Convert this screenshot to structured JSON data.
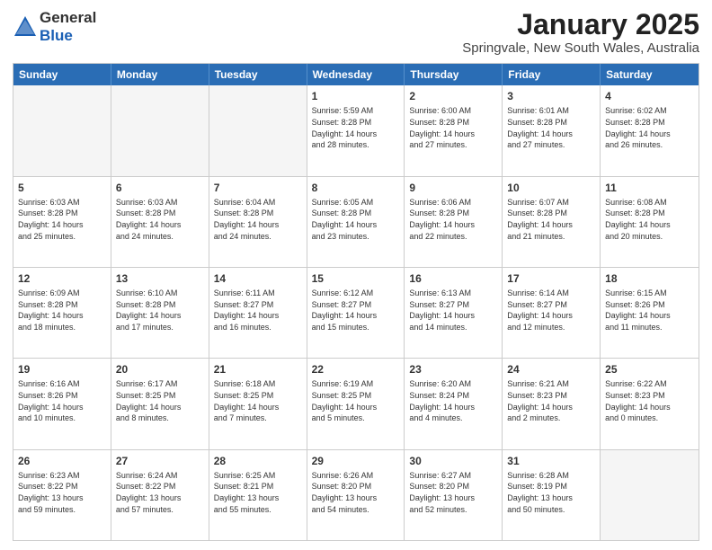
{
  "header": {
    "logo_general": "General",
    "logo_blue": "Blue",
    "month_title": "January 2025",
    "location": "Springvale, New South Wales, Australia"
  },
  "days_of_week": [
    "Sunday",
    "Monday",
    "Tuesday",
    "Wednesday",
    "Thursday",
    "Friday",
    "Saturday"
  ],
  "weeks": [
    [
      {
        "day": "",
        "info": ""
      },
      {
        "day": "",
        "info": ""
      },
      {
        "day": "",
        "info": ""
      },
      {
        "day": "1",
        "info": "Sunrise: 5:59 AM\nSunset: 8:28 PM\nDaylight: 14 hours\nand 28 minutes."
      },
      {
        "day": "2",
        "info": "Sunrise: 6:00 AM\nSunset: 8:28 PM\nDaylight: 14 hours\nand 27 minutes."
      },
      {
        "day": "3",
        "info": "Sunrise: 6:01 AM\nSunset: 8:28 PM\nDaylight: 14 hours\nand 27 minutes."
      },
      {
        "day": "4",
        "info": "Sunrise: 6:02 AM\nSunset: 8:28 PM\nDaylight: 14 hours\nand 26 minutes."
      }
    ],
    [
      {
        "day": "5",
        "info": "Sunrise: 6:03 AM\nSunset: 8:28 PM\nDaylight: 14 hours\nand 25 minutes."
      },
      {
        "day": "6",
        "info": "Sunrise: 6:03 AM\nSunset: 8:28 PM\nDaylight: 14 hours\nand 24 minutes."
      },
      {
        "day": "7",
        "info": "Sunrise: 6:04 AM\nSunset: 8:28 PM\nDaylight: 14 hours\nand 24 minutes."
      },
      {
        "day": "8",
        "info": "Sunrise: 6:05 AM\nSunset: 8:28 PM\nDaylight: 14 hours\nand 23 minutes."
      },
      {
        "day": "9",
        "info": "Sunrise: 6:06 AM\nSunset: 8:28 PM\nDaylight: 14 hours\nand 22 minutes."
      },
      {
        "day": "10",
        "info": "Sunrise: 6:07 AM\nSunset: 8:28 PM\nDaylight: 14 hours\nand 21 minutes."
      },
      {
        "day": "11",
        "info": "Sunrise: 6:08 AM\nSunset: 8:28 PM\nDaylight: 14 hours\nand 20 minutes."
      }
    ],
    [
      {
        "day": "12",
        "info": "Sunrise: 6:09 AM\nSunset: 8:28 PM\nDaylight: 14 hours\nand 18 minutes."
      },
      {
        "day": "13",
        "info": "Sunrise: 6:10 AM\nSunset: 8:28 PM\nDaylight: 14 hours\nand 17 minutes."
      },
      {
        "day": "14",
        "info": "Sunrise: 6:11 AM\nSunset: 8:27 PM\nDaylight: 14 hours\nand 16 minutes."
      },
      {
        "day": "15",
        "info": "Sunrise: 6:12 AM\nSunset: 8:27 PM\nDaylight: 14 hours\nand 15 minutes."
      },
      {
        "day": "16",
        "info": "Sunrise: 6:13 AM\nSunset: 8:27 PM\nDaylight: 14 hours\nand 14 minutes."
      },
      {
        "day": "17",
        "info": "Sunrise: 6:14 AM\nSunset: 8:27 PM\nDaylight: 14 hours\nand 12 minutes."
      },
      {
        "day": "18",
        "info": "Sunrise: 6:15 AM\nSunset: 8:26 PM\nDaylight: 14 hours\nand 11 minutes."
      }
    ],
    [
      {
        "day": "19",
        "info": "Sunrise: 6:16 AM\nSunset: 8:26 PM\nDaylight: 14 hours\nand 10 minutes."
      },
      {
        "day": "20",
        "info": "Sunrise: 6:17 AM\nSunset: 8:25 PM\nDaylight: 14 hours\nand 8 minutes."
      },
      {
        "day": "21",
        "info": "Sunrise: 6:18 AM\nSunset: 8:25 PM\nDaylight: 14 hours\nand 7 minutes."
      },
      {
        "day": "22",
        "info": "Sunrise: 6:19 AM\nSunset: 8:25 PM\nDaylight: 14 hours\nand 5 minutes."
      },
      {
        "day": "23",
        "info": "Sunrise: 6:20 AM\nSunset: 8:24 PM\nDaylight: 14 hours\nand 4 minutes."
      },
      {
        "day": "24",
        "info": "Sunrise: 6:21 AM\nSunset: 8:23 PM\nDaylight: 14 hours\nand 2 minutes."
      },
      {
        "day": "25",
        "info": "Sunrise: 6:22 AM\nSunset: 8:23 PM\nDaylight: 14 hours\nand 0 minutes."
      }
    ],
    [
      {
        "day": "26",
        "info": "Sunrise: 6:23 AM\nSunset: 8:22 PM\nDaylight: 13 hours\nand 59 minutes."
      },
      {
        "day": "27",
        "info": "Sunrise: 6:24 AM\nSunset: 8:22 PM\nDaylight: 13 hours\nand 57 minutes."
      },
      {
        "day": "28",
        "info": "Sunrise: 6:25 AM\nSunset: 8:21 PM\nDaylight: 13 hours\nand 55 minutes."
      },
      {
        "day": "29",
        "info": "Sunrise: 6:26 AM\nSunset: 8:20 PM\nDaylight: 13 hours\nand 54 minutes."
      },
      {
        "day": "30",
        "info": "Sunrise: 6:27 AM\nSunset: 8:20 PM\nDaylight: 13 hours\nand 52 minutes."
      },
      {
        "day": "31",
        "info": "Sunrise: 6:28 AM\nSunset: 8:19 PM\nDaylight: 13 hours\nand 50 minutes."
      },
      {
        "day": "",
        "info": ""
      }
    ]
  ]
}
